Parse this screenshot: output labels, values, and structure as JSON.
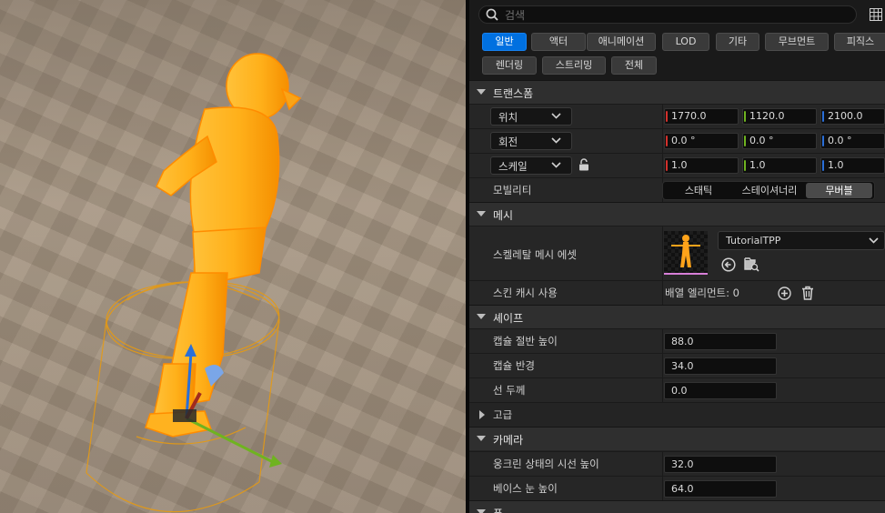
{
  "search": {
    "placeholder": "검색"
  },
  "filters": {
    "row1": [
      "일반",
      "액터",
      "애니메이션",
      "LOD",
      "기타",
      "무브먼트",
      "피직스"
    ],
    "row2": [
      "렌더링",
      "스트리밍",
      "전체"
    ],
    "active": "일반"
  },
  "sections": {
    "transform": "트랜스폼",
    "mesh": "메시",
    "shape": "셰이프",
    "advanced": "고급",
    "camera": "카메라",
    "bottom": "폰"
  },
  "transform": {
    "location": {
      "mode": "위치",
      "x": "1770.0",
      "y": "1120.0",
      "z": "2100.0"
    },
    "rotation": {
      "mode": "회전",
      "x": "0.0 °",
      "y": "0.0 °",
      "z": "0.0 °"
    },
    "scale": {
      "mode": "스케일",
      "x": "1.0",
      "y": "1.0",
      "z": "1.0"
    },
    "mobility": {
      "label": "모빌리티",
      "options": [
        "스태틱",
        "스테이셔너리",
        "무버블"
      ],
      "selected": "무버블"
    }
  },
  "mesh": {
    "skeletal_mesh_label": "스켈레탈 메시 에셋",
    "asset_name": "TutorialTPP",
    "skin_cache_label": "스킨 캐시 사용",
    "array_elements": "배열 엘리먼트: 0"
  },
  "shape": {
    "half_height_label": "캡슐 절반 높이",
    "half_height": "88.0",
    "radius_label": "캡슐 반경",
    "radius": "34.0",
    "line_thickness_label": "선 두께",
    "line_thickness": "0.0"
  },
  "camera": {
    "crouched_eye_label": "웅크린 상태의 시선 높이",
    "crouched_eye": "32.0",
    "base_eye_label": "베이스 눈 높이",
    "base_eye": "64.0"
  },
  "colors": {
    "accent": "#0070e0",
    "axis_x": "#d3302b",
    "axis_y": "#6fb320",
    "axis_z": "#2a6fd8",
    "selection": "#ffa500"
  }
}
